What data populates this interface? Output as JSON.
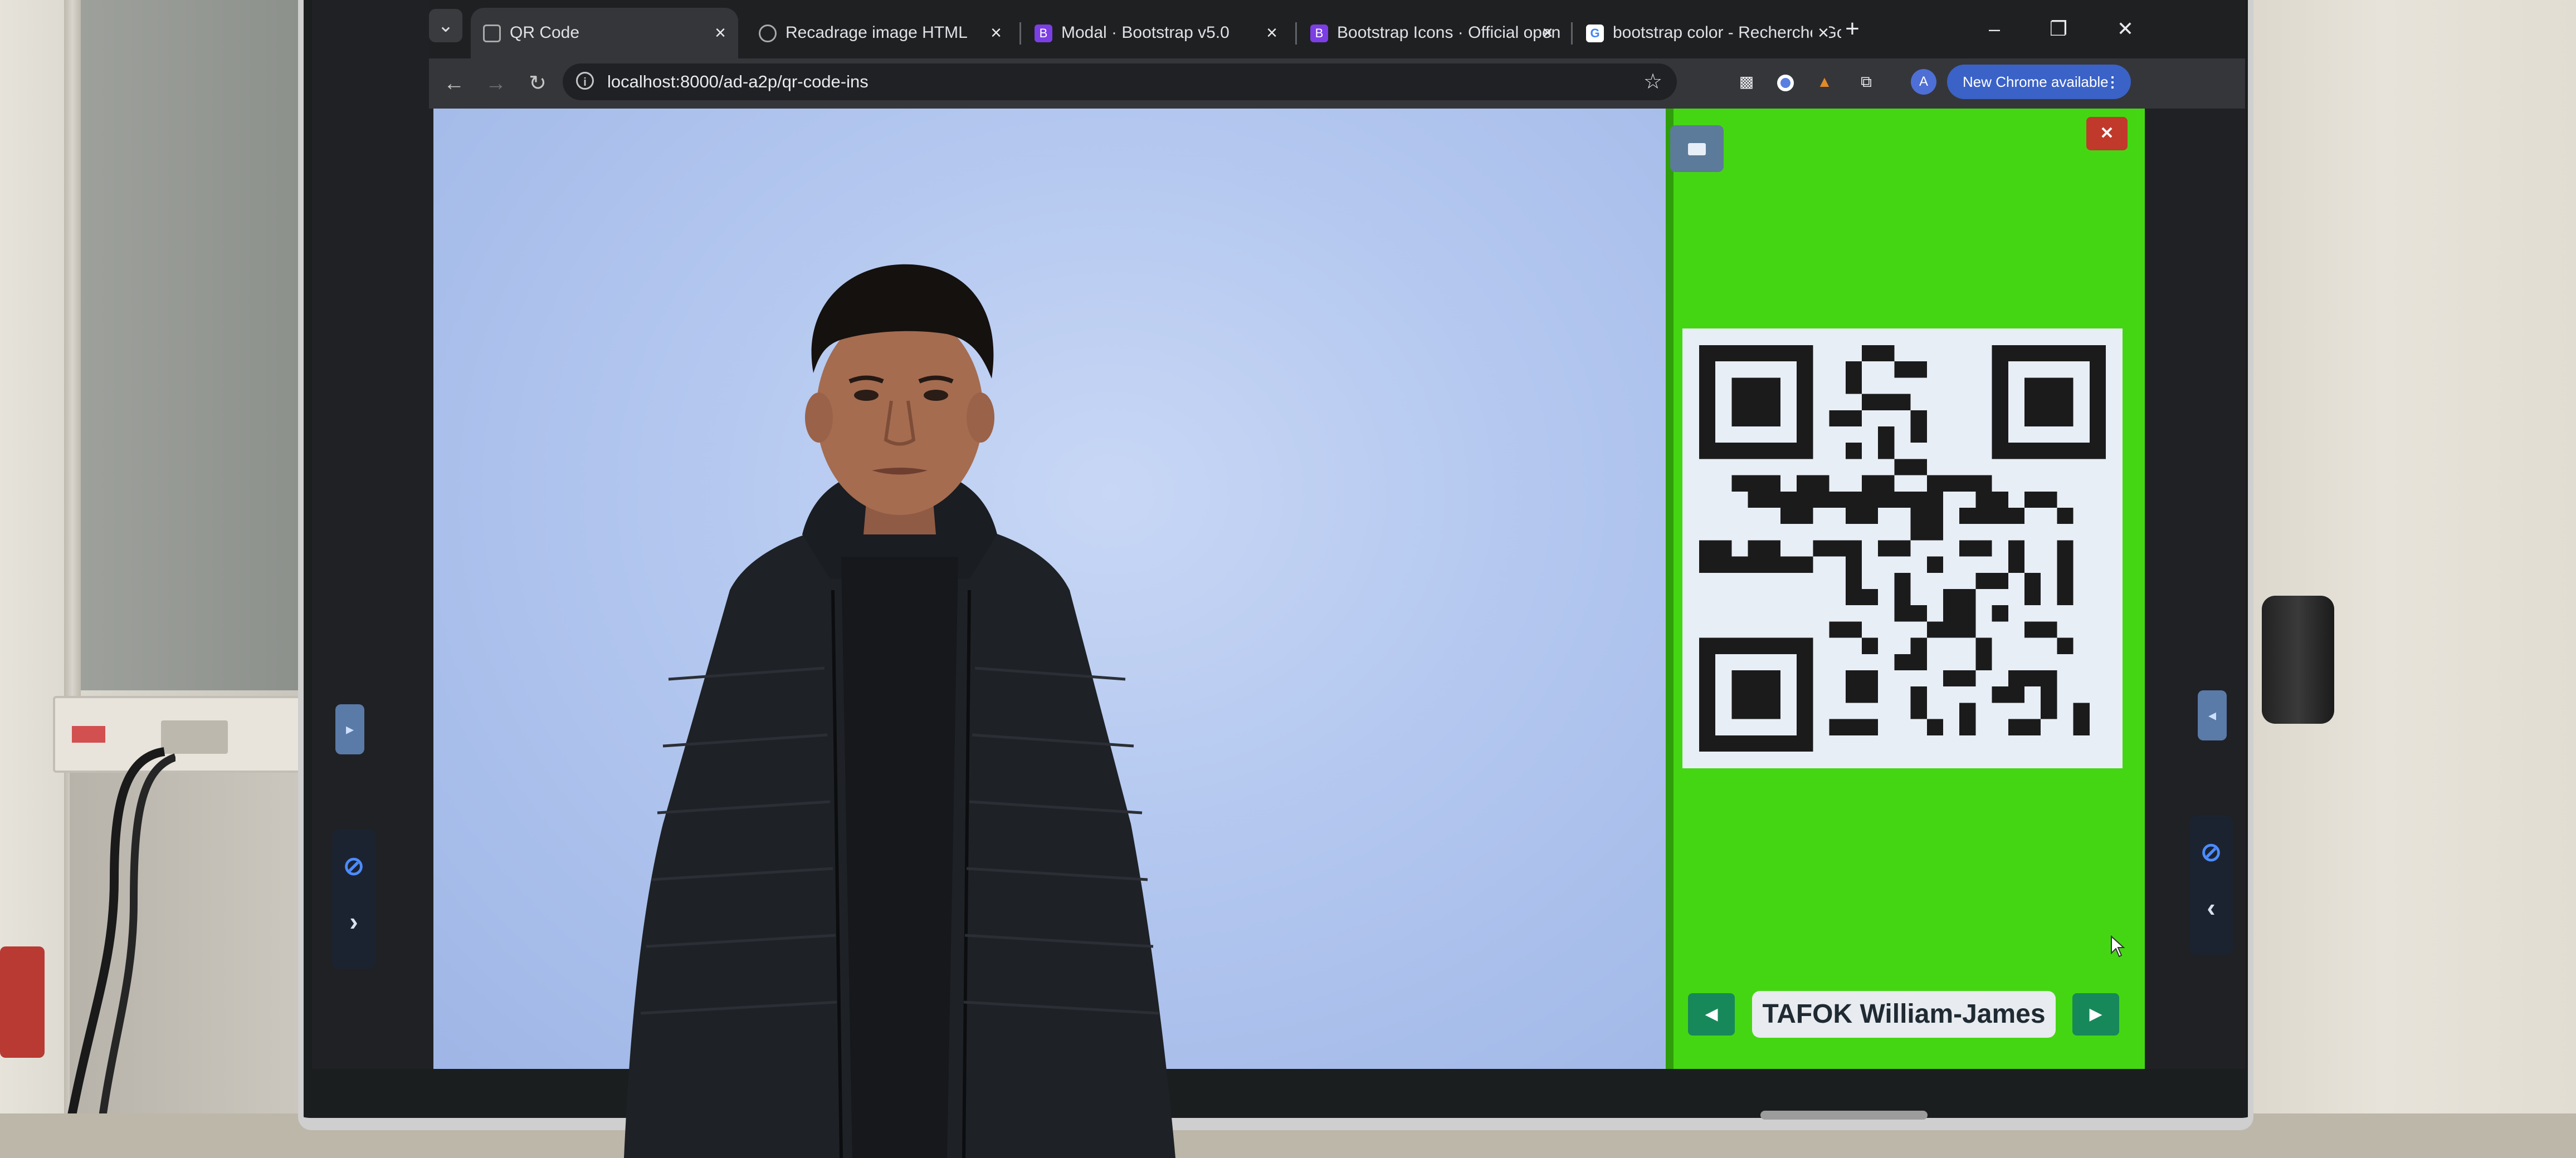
{
  "browser": {
    "tabs": [
      {
        "title": "QR Code",
        "icon": "qr-code-icon",
        "active": true
      },
      {
        "title": "Recadrage image HTML",
        "icon": "globe-icon",
        "active": false
      },
      {
        "title": "Modal · Bootstrap v5.0",
        "icon": "bootstrap-icon",
        "icon_glyph": "B",
        "active": false
      },
      {
        "title": "Bootstrap Icons · Official open s",
        "icon": "bootstrap-icon",
        "icon_glyph": "B",
        "active": false
      },
      {
        "title": "bootstrap color - Recherche Go",
        "icon": "google-icon",
        "icon_glyph": "G",
        "active": false
      }
    ],
    "url": "localhost:8000/ad-a2p/qr-code-ins",
    "update_label": "New Chrome available",
    "avatar_initial": "A"
  },
  "qr_panel": {
    "background_color": "#45d613",
    "student_name": "TAFOK William-James"
  },
  "colors": {
    "close_button": "#c0392b",
    "nav_arrow": "#17885a",
    "photo_backdrop": "#b3c7ef"
  }
}
